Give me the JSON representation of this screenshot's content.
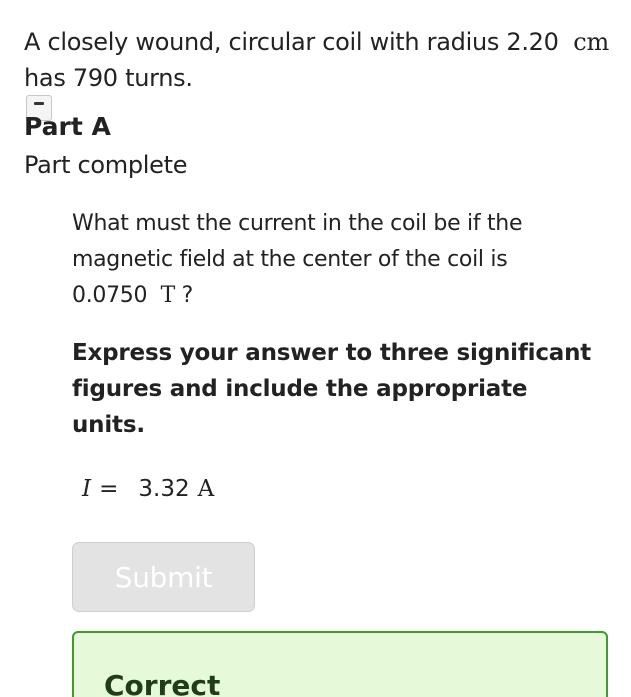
{
  "problem": {
    "text": "A closely wound, circular coil with radius 2.20",
    "unit": "cm",
    "text_line2": "has 790 turns."
  },
  "part": {
    "collapse_icon": "minus-icon",
    "title": "Part A",
    "status": "Part complete"
  },
  "question": {
    "text": "What must the current in the coil be if the magnetic field at the center of the coil is 0.0750",
    "unit": "T",
    "end": "?"
  },
  "instructions": "Express your answer to three significant figures and include the appropriate units.",
  "answer": {
    "variable": "I",
    "equals": "=",
    "value": "3.32",
    "unit": "A"
  },
  "submit": {
    "label": "Submit",
    "state": "disabled"
  },
  "feedback": {
    "title": "Correct",
    "color": "#3f9b2e",
    "background": "#e6f9d8"
  }
}
